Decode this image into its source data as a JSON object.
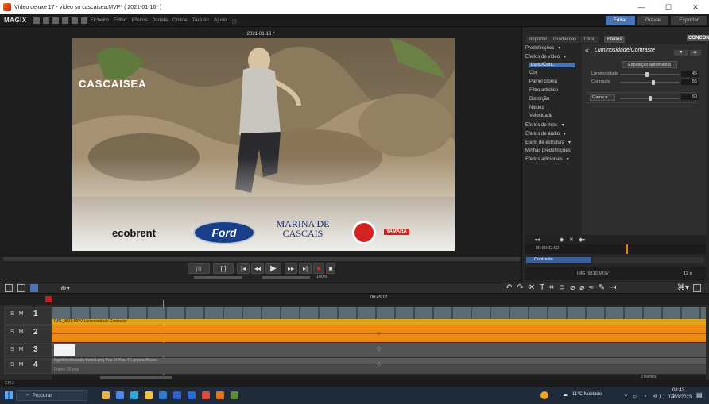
{
  "window": {
    "title": "Vídeo deluxe 17 - vídeo só cascaisea.MVP* ( 2021-01-16* )"
  },
  "menubar": {
    "logo": "MAGIX",
    "items": [
      "Ficheiro",
      "Editar",
      "Efeitos",
      "Janela",
      "Online",
      "Tarefas",
      "Ajuda"
    ],
    "modes": {
      "edit": "Editar",
      "record": "Gravar",
      "export": "Exportar"
    }
  },
  "preview": {
    "date_label": "2021-01-16 *",
    "brand_logo": "CASCAISEA",
    "sponsors": [
      "ecobrent",
      "Ford",
      "MARINA DE CASCAIS",
      "YAMAHA"
    ]
  },
  "transport": {
    "zoom": "100%"
  },
  "right_panel": {
    "tabs": [
      "Importar",
      "Gradações",
      "Título",
      "Efeitos"
    ],
    "corner_logo": "CONCON",
    "categories": [
      {
        "label": "Predefinições",
        "arrow": "▾",
        "indent": false,
        "selected": false
      },
      {
        "label": "Efeitos de vídeo",
        "arrow": "▾",
        "indent": false,
        "selected": false
      },
      {
        "label": "Lum./Cont.",
        "arrow": "",
        "indent": true,
        "selected": true
      },
      {
        "label": "Cor",
        "arrow": "",
        "indent": true,
        "selected": false
      },
      {
        "label": "Painel croma",
        "arrow": "",
        "indent": true,
        "selected": false
      },
      {
        "label": "Filtro artístico",
        "arrow": "",
        "indent": true,
        "selected": false
      },
      {
        "label": "Distorção",
        "arrow": "",
        "indent": true,
        "selected": false
      },
      {
        "label": "Nitidez",
        "arrow": "",
        "indent": true,
        "selected": false
      },
      {
        "label": "Velocidade",
        "arrow": "",
        "indent": true,
        "selected": false
      },
      {
        "label": "Efeitos de mov.",
        "arrow": "▾",
        "indent": false,
        "selected": false
      },
      {
        "label": "Efeitos de áudio",
        "arrow": "▾",
        "indent": false,
        "selected": false
      },
      {
        "label": "Elem. de estrutura",
        "arrow": "▾",
        "indent": false,
        "selected": false
      },
      {
        "label": "Minhas predefinições",
        "arrow": "",
        "indent": false,
        "selected": false
      },
      {
        "label": "Efeitos adicionais",
        "arrow": "▾",
        "indent": false,
        "selected": false
      }
    ],
    "effect": {
      "title": "Luminosidade/Contraste",
      "auto_button": "Exposição automática",
      "sliders": [
        {
          "label": "Luminosidade",
          "value": "45",
          "level": 0.45
        },
        {
          "label": "Contraste",
          "value": "56",
          "level": 0.56
        }
      ],
      "gamma_label": "Gama",
      "gamma_value": "50",
      "gamma_level": 0.5
    },
    "keyframe": {
      "timecode": "00:00:02:02",
      "track_label": "Contraste",
      "clip_name": "IMG_9810.MOV",
      "counter": "12 s"
    }
  },
  "timeline": {
    "position": "00:45:17",
    "tracks": [
      {
        "mute": "S M",
        "num": "1",
        "clip_label": "IMG_9810.MOV  Luminosidade  Contraste",
        "color": "#e39a1a"
      },
      {
        "mute": "S M",
        "num": "2",
        "clip_label": "",
        "color": "#ee8a12"
      },
      {
        "mute": "S M",
        "num": "3",
        "clip_label": "",
        "color": "#555555"
      },
      {
        "mute": "S M",
        "num": "4",
        "clip_label": "logotipo docpada frontal.png  Pos. X  Pos. Y  Largura  Altura",
        "color": "#4a4a4a"
      }
    ],
    "bottom_label": "Frame 00.png",
    "zoom_label": "3 frames",
    "status": "CPU: —"
  },
  "taskbar": {
    "search_placeholder": "Procurar",
    "weather": "11°C  Nublado",
    "time": "08:42",
    "date": "07/03/2023"
  }
}
